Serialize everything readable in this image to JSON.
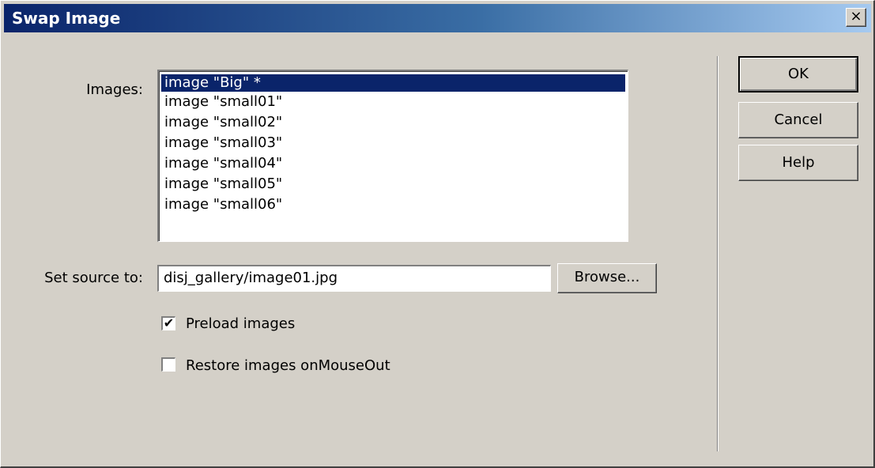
{
  "window": {
    "title": "Swap Image",
    "close_label": "×"
  },
  "images": {
    "label": "Images:",
    "items": [
      "image \"Big\" *",
      "image \"small01\"",
      "image \"small02\"",
      "image \"small03\"",
      "image \"small04\"",
      "image \"small05\"",
      "image \"small06\""
    ],
    "selected_index": 0
  },
  "source": {
    "label": "Set source to:",
    "value": "disj_gallery/image01.jpg",
    "browse_label": "Browse..."
  },
  "options": {
    "preload_label": "Preload images",
    "preload_checked": true,
    "restore_label": "Restore images onMouseOut",
    "restore_checked": false,
    "check_mark": "✔"
  },
  "buttons": {
    "ok": "OK",
    "cancel": "Cancel",
    "help": "Help"
  },
  "colors": {
    "selection": "#0a246a",
    "dialog_bg": "#d4d0c8"
  }
}
